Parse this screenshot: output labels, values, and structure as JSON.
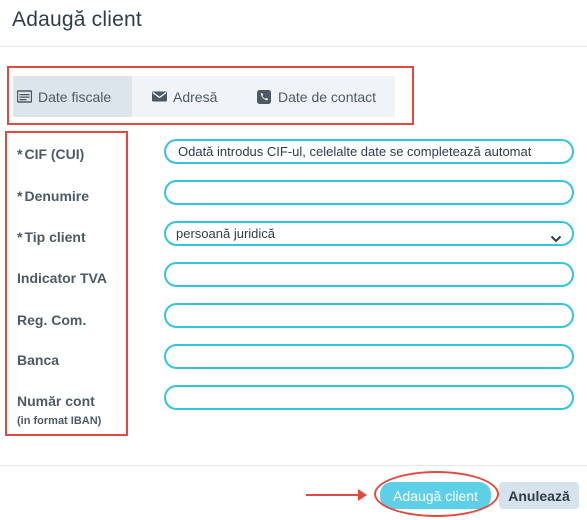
{
  "dialog": {
    "title": "Adaugă client"
  },
  "tabs": [
    {
      "label": "Date fiscale",
      "icon": "id-card-icon",
      "active": true
    },
    {
      "label": "Adresă",
      "icon": "envelope-icon",
      "active": false
    },
    {
      "label": "Date de contact",
      "icon": "phone-icon",
      "active": false
    }
  ],
  "form": {
    "cif": {
      "label": "CIF (CUI)",
      "required": "*",
      "placeholder": "Odată introdus CIF-ul, celelalte date se completează automat",
      "value": ""
    },
    "denumire": {
      "label": "Denumire",
      "required": "*",
      "value": ""
    },
    "tip_client": {
      "label": "Tip client",
      "required": "*",
      "value": "persoană juridică"
    },
    "indicator_tva": {
      "label": "Indicator TVA",
      "value": ""
    },
    "reg_com": {
      "label": "Reg. Com.",
      "value": ""
    },
    "banca": {
      "label": "Banca",
      "value": ""
    },
    "numar_cont": {
      "label": "Număr cont",
      "sublabel": "(in format IBAN)",
      "value": ""
    }
  },
  "footer": {
    "add_label": "Adaugă client",
    "cancel_label": "Anulează"
  },
  "colors": {
    "accent": "#35c4de",
    "primary_button": "#5dd0e7",
    "annotation": "#e04a3f"
  }
}
